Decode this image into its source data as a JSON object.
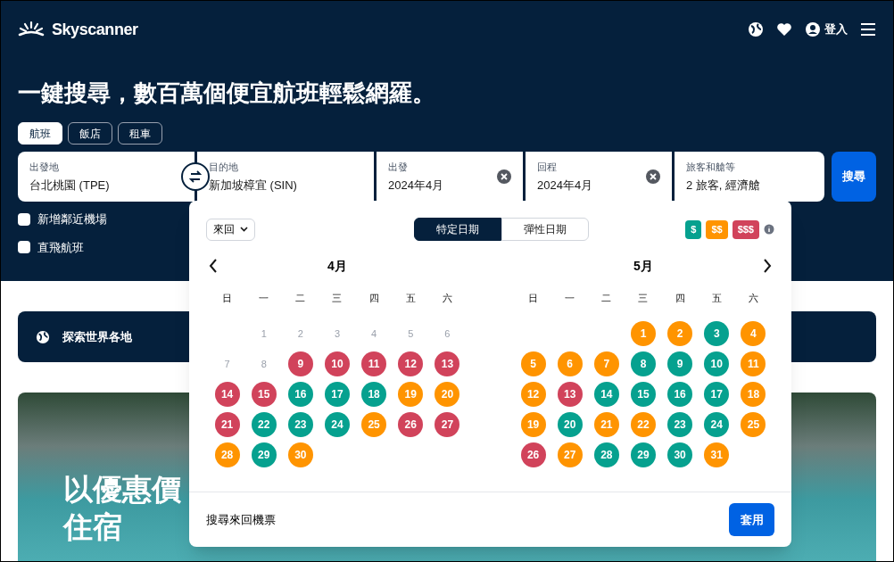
{
  "header": {
    "logo": "Skyscanner",
    "login": "登入"
  },
  "headline": "一鍵搜尋，數百萬個便宜航班輕鬆網羅。",
  "tabs": [
    {
      "label": "航班",
      "selected": true
    },
    {
      "label": "飯店",
      "selected": false
    },
    {
      "label": "租車",
      "selected": false
    }
  ],
  "search_fields": [
    {
      "label": "出發地",
      "value": "台北桃園 (TPE)",
      "clearable": false
    },
    {
      "label": "目的地",
      "value": "新加坡樟宜 (SIN)",
      "clearable": false
    },
    {
      "label": "出發",
      "value": "2024年4月",
      "clearable": true
    },
    {
      "label": "回程",
      "value": "2024年4月",
      "clearable": true
    },
    {
      "label": "旅客和艙等",
      "value": "2 旅客, 經濟艙",
      "clearable": false
    }
  ],
  "search_button": "搜尋",
  "options": [
    {
      "label": "新增鄰近機場",
      "checked": false
    },
    {
      "label": "直飛航班",
      "checked": false
    }
  ],
  "explore": "探索世界各地",
  "hero_title": [
    "以優惠價",
    "住宿"
  ],
  "calendar": {
    "trip_type": "來回",
    "modes": [
      {
        "label": "特定日期",
        "selected": true
      },
      {
        "label": "彈性日期",
        "selected": false
      }
    ],
    "legend": [
      {
        "label": "$",
        "color": "#06a18f"
      },
      {
        "label": "$$",
        "color": "#ff9400"
      },
      {
        "label": "$$$",
        "color": "#d1435b"
      }
    ],
    "months": [
      {
        "title": "4月",
        "weekdays": [
          "日",
          "一",
          "二",
          "三",
          "四",
          "五",
          "六"
        ],
        "weeks": [
          [
            {
              "kind": "blank"
            },
            {
              "kind": "day",
              "day": "1",
              "disabled": true
            },
            {
              "kind": "day",
              "day": "2",
              "disabled": true
            },
            {
              "kind": "day",
              "day": "3",
              "disabled": true
            },
            {
              "kind": "day",
              "day": "4",
              "disabled": true
            },
            {
              "kind": "day",
              "day": "5",
              "disabled": true
            },
            {
              "kind": "day",
              "day": "6",
              "disabled": true
            }
          ],
          [
            {
              "kind": "day",
              "day": "7",
              "disabled": true
            },
            {
              "kind": "day",
              "day": "8",
              "disabled": true
            },
            {
              "kind": "day",
              "day": "9",
              "color": "#d1435b"
            },
            {
              "kind": "day",
              "day": "10",
              "color": "#d1435b"
            },
            {
              "kind": "day",
              "day": "11",
              "color": "#d1435b"
            },
            {
              "kind": "day",
              "day": "12",
              "color": "#d1435b"
            },
            {
              "kind": "day",
              "day": "13",
              "color": "#d1435b"
            }
          ],
          [
            {
              "kind": "day",
              "day": "14",
              "color": "#d1435b"
            },
            {
              "kind": "day",
              "day": "15",
              "color": "#d1435b"
            },
            {
              "kind": "day",
              "day": "16",
              "color": "#06a18f"
            },
            {
              "kind": "day",
              "day": "17",
              "color": "#06a18f"
            },
            {
              "kind": "day",
              "day": "18",
              "color": "#06a18f"
            },
            {
              "kind": "day",
              "day": "19",
              "color": "#ff9400"
            },
            {
              "kind": "day",
              "day": "20",
              "color": "#ff9400"
            }
          ],
          [
            {
              "kind": "day",
              "day": "21",
              "color": "#d1435b"
            },
            {
              "kind": "day",
              "day": "22",
              "color": "#06a18f"
            },
            {
              "kind": "day",
              "day": "23",
              "color": "#06a18f"
            },
            {
              "kind": "day",
              "day": "24",
              "color": "#06a18f"
            },
            {
              "kind": "day",
              "day": "25",
              "color": "#ff9400"
            },
            {
              "kind": "day",
              "day": "26",
              "color": "#d1435b"
            },
            {
              "kind": "day",
              "day": "27",
              "color": "#d1435b"
            }
          ],
          [
            {
              "kind": "day",
              "day": "28",
              "color": "#ff9400"
            },
            {
              "kind": "day",
              "day": "29",
              "color": "#06a18f"
            },
            {
              "kind": "day",
              "day": "30",
              "color": "#ff9400"
            }
          ]
        ]
      },
      {
        "title": "5月",
        "weekdays": [
          "日",
          "一",
          "二",
          "三",
          "四",
          "五",
          "六"
        ],
        "weeks": [
          [
            {
              "kind": "blank"
            },
            {
              "kind": "blank"
            },
            {
              "kind": "blank"
            },
            {
              "kind": "day",
              "day": "1",
              "color": "#ff9400"
            },
            {
              "kind": "day",
              "day": "2",
              "color": "#ff9400"
            },
            {
              "kind": "day",
              "day": "3",
              "color": "#06a18f"
            },
            {
              "kind": "day",
              "day": "4",
              "color": "#ff9400"
            }
          ],
          [
            {
              "kind": "day",
              "day": "5",
              "color": "#ff9400"
            },
            {
              "kind": "day",
              "day": "6",
              "color": "#ff9400"
            },
            {
              "kind": "day",
              "day": "7",
              "color": "#ff9400"
            },
            {
              "kind": "day",
              "day": "8",
              "color": "#06a18f"
            },
            {
              "kind": "day",
              "day": "9",
              "color": "#06a18f"
            },
            {
              "kind": "day",
              "day": "10",
              "color": "#06a18f"
            },
            {
              "kind": "day",
              "day": "11",
              "color": "#ff9400"
            }
          ],
          [
            {
              "kind": "day",
              "day": "12",
              "color": "#ff9400"
            },
            {
              "kind": "day",
              "day": "13",
              "color": "#d1435b"
            },
            {
              "kind": "day",
              "day": "14",
              "color": "#06a18f"
            },
            {
              "kind": "day",
              "day": "15",
              "color": "#06a18f"
            },
            {
              "kind": "day",
              "day": "16",
              "color": "#06a18f"
            },
            {
              "kind": "day",
              "day": "17",
              "color": "#06a18f"
            },
            {
              "kind": "day",
              "day": "18",
              "color": "#ff9400"
            }
          ],
          [
            {
              "kind": "day",
              "day": "19",
              "color": "#ff9400"
            },
            {
              "kind": "day",
              "day": "20",
              "color": "#06a18f"
            },
            {
              "kind": "day",
              "day": "21",
              "color": "#ff9400"
            },
            {
              "kind": "day",
              "day": "22",
              "color": "#ff9400"
            },
            {
              "kind": "day",
              "day": "23",
              "color": "#06a18f"
            },
            {
              "kind": "day",
              "day": "24",
              "color": "#06a18f"
            },
            {
              "kind": "day",
              "day": "25",
              "color": "#ff9400"
            }
          ],
          [
            {
              "kind": "day",
              "day": "26",
              "color": "#d1435b"
            },
            {
              "kind": "day",
              "day": "27",
              "color": "#ff9400"
            },
            {
              "kind": "day",
              "day": "28",
              "color": "#06a18f"
            },
            {
              "kind": "day",
              "day": "29",
              "color": "#06a18f"
            },
            {
              "kind": "day",
              "day": "30",
              "color": "#06a18f"
            },
            {
              "kind": "day",
              "day": "31",
              "color": "#ff9400"
            }
          ]
        ]
      }
    ],
    "footer_text": "搜尋來回機票",
    "apply_button": "套用"
  }
}
